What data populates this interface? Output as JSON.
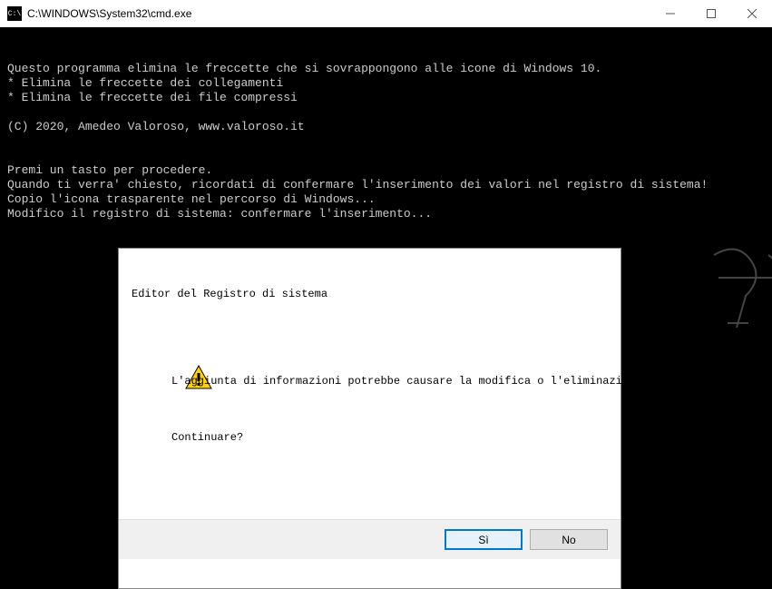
{
  "window": {
    "icon_text": "C:\\",
    "title": "C:\\WINDOWS\\System32\\cmd.exe"
  },
  "console": {
    "lines": [
      "",
      "Questo programma elimina le freccette che si sovrappongono alle icone di Windows 10.",
      "* Elimina le freccette dei collegamenti",
      "* Elimina le freccette dei file compressi",
      "",
      "(C) 2020, Amedeo Valoroso, www.valoroso.it",
      "",
      "",
      "Premi un tasto per procedere.",
      "Quando ti verra' chiesto, ricordati di confermare l'inserimento dei valori nel registro di sistema!",
      "Copio l'icona trasparente nel percorso di Windows...",
      "Modifico il registro di sistema: confermare l'inserimento..."
    ]
  },
  "dialog": {
    "title": "Editor del Registro di sistema",
    "message": "L'aggiunta di informazioni potrebbe causare la modifica o l'eliminazione non intenzionale di valori e impedire il corretto funzionamento dei componenti. Se non si ritiene attendibile l'origine di tali informazioni in C:\\Condivisa\\Transparent.reg, non aggiungerle al Registro di sistema.",
    "question": "Continuare?",
    "yes": "Sì",
    "no": "No"
  }
}
